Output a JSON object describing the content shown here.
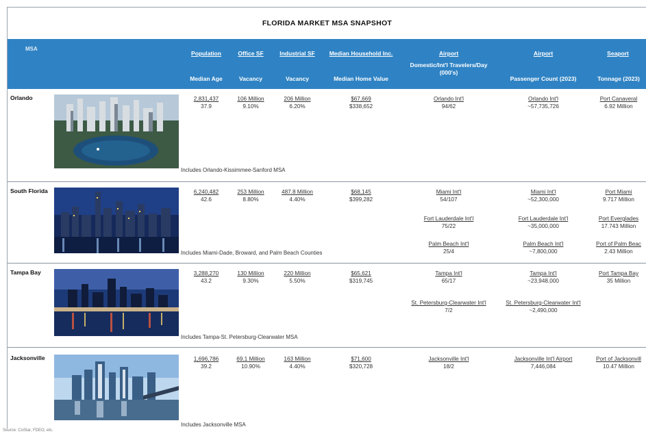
{
  "title": "FLORIDA MARKET MSA SNAPSHOT",
  "header": {
    "msa": "MSA",
    "population": "Population",
    "median_age": "Median Age",
    "office_sf": "Office SF",
    "office_vacancy": "Vacancy",
    "industrial_sf": "Industrial SF",
    "industrial_vacancy": "Vacancy",
    "median_hh_inc": "Median Household Inc.",
    "median_home_value": "Median Home Value",
    "airport1": "Airport",
    "airport1_sub_a": "Domestic/Int'l Travelers/Day",
    "airport1_sub_b": "(000's)",
    "airport2": "Airport",
    "airport2_sub": "Passenger Count (2023)",
    "seaport": "Seaport",
    "seaport_sub": "Tonnage (2023)"
  },
  "rows": [
    {
      "name": "Orlando",
      "population": "2,831,437",
      "median_age": "37.9",
      "office_sf": "106 Million",
      "office_vacancy": "9.10%",
      "industrial_sf": "206 Million",
      "industrial_vacancy": "6.20%",
      "median_hh_inc": "$67,669",
      "median_home_value": "$338,652",
      "travelers": [
        {
          "name": "Orlando Int'l",
          "value": "94/62"
        }
      ],
      "passengers": [
        {
          "name": "Orlando Int'l",
          "value": "~57,735,726"
        }
      ],
      "seaports": [
        {
          "name": "Port Canaveral",
          "value": "6.92 Million"
        }
      ],
      "note": "Includes Orlando-Kissimmee-Sanford MSA"
    },
    {
      "name": "South Florida",
      "population": "6,240,482",
      "median_age": "42.6",
      "office_sf": "253 Million",
      "office_vacancy": "8.80%",
      "industrial_sf": "487.8 Million",
      "industrial_vacancy": "4.40%",
      "median_hh_inc": "$68,145",
      "median_home_value": "$399,282",
      "travelers": [
        {
          "name": "Miami Int'l",
          "value": "54/107"
        },
        {
          "name": "Fort Lauderdale Int'l",
          "value": "75/22"
        },
        {
          "name": "Palm Beach Int'l",
          "value": "25/4"
        }
      ],
      "passengers": [
        {
          "name": "Miami Int'l",
          "value": "~52,300,000"
        },
        {
          "name": "Fort Lauderdale Int'l",
          "value": "~35,000,000"
        },
        {
          "name": "Palm Beach Int'l",
          "value": "~7,800,000"
        }
      ],
      "seaports": [
        {
          "name": "Port Miami",
          "value": "9.717 Million"
        },
        {
          "name": "Port Everglades",
          "value": "17.743 Million"
        },
        {
          "name": "Port of Palm Beac",
          "value": "2.43 Million"
        }
      ],
      "note": "Includes Miami-Dade, Broward, and Palm Beach Counties"
    },
    {
      "name": "Tampa Bay",
      "population": "3,288,270",
      "median_age": "43.2",
      "office_sf": "130 Million",
      "office_vacancy": "9.30%",
      "industrial_sf": "220 Million",
      "industrial_vacancy": "5.50%",
      "median_hh_inc": "$65,621",
      "median_home_value": "$319,745",
      "travelers": [
        {
          "name": "Tampa Int'l",
          "value": "65/17"
        },
        {
          "name": "St. Petersburg-Clearwater Int'l",
          "value": "7/2"
        }
      ],
      "passengers": [
        {
          "name": "Tampa Int'l",
          "value": "~23,948,000"
        },
        {
          "name": "St. Petersburg-Clearwater Int'l",
          "value": "~2,490,000"
        }
      ],
      "seaports": [
        {
          "name": "Port Tampa Bay",
          "value": "35 Million"
        }
      ],
      "note": "Includes Tampa-St. Petersburg-Clearwater MSA"
    },
    {
      "name": "Jacksonville",
      "population": "1,696,786",
      "median_age": "39.2",
      "office_sf": "69.1 Million",
      "office_vacancy": "10.90%",
      "industrial_sf": "163 Million",
      "industrial_vacancy": "4.40%",
      "median_hh_inc": "$71,600",
      "median_home_value": "$320,728",
      "travelers": [
        {
          "name": "Jacksonville Int'l",
          "value": "18/2"
        }
      ],
      "passengers": [
        {
          "name": "Jacksonville Int'l Airport",
          "value": "7,446,084"
        }
      ],
      "seaports": [
        {
          "name": "Port of Jacksonvill",
          "value": "10.47 Million"
        }
      ],
      "note": "Includes Jacksonville MSA"
    }
  ],
  "source": "Source: CoStar, FDEO, etc.",
  "colors": {
    "header_bg": "#2f83c4",
    "header_text": "#ffffff",
    "divider": "#8a949e"
  }
}
